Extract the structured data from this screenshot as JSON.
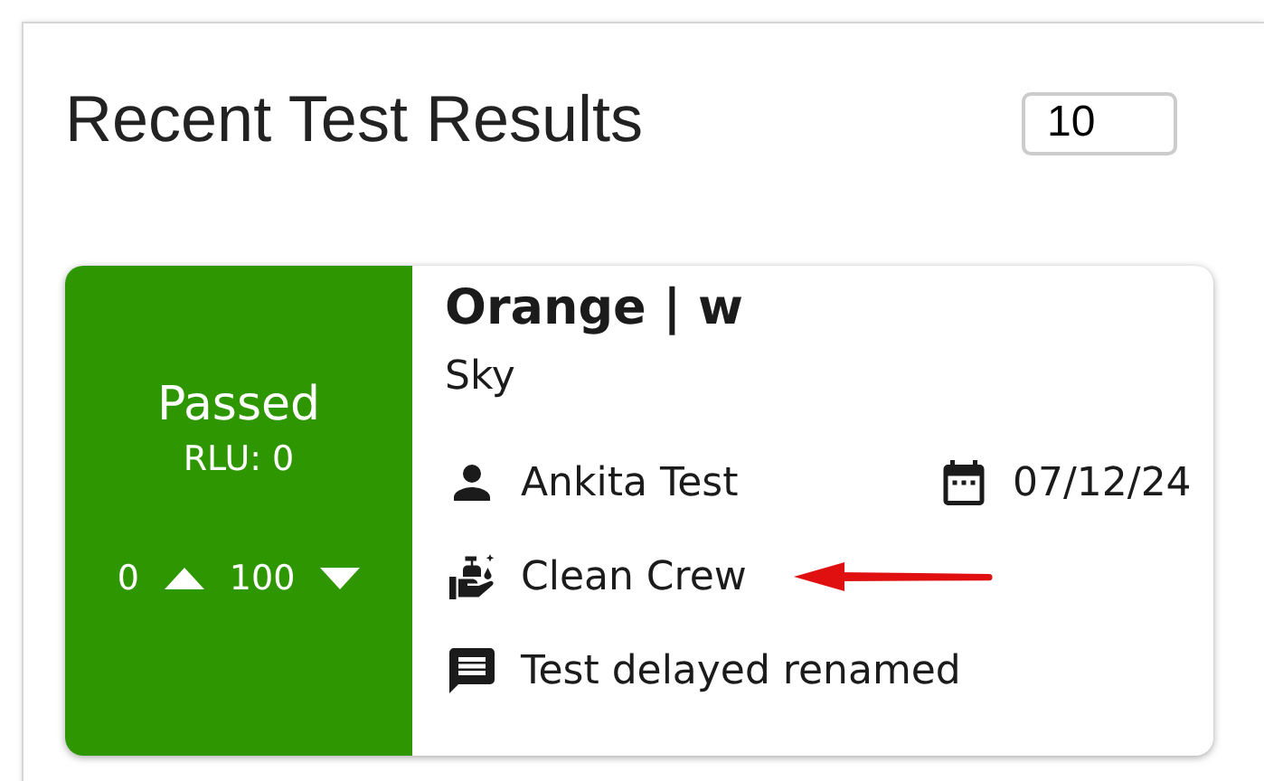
{
  "panel": {
    "title": "Recent Test Results",
    "count_field": {
      "value": "10"
    }
  },
  "results": [
    {
      "status": "Passed",
      "color": "#2e9600",
      "rlu": "RLU: 0",
      "low": "0",
      "high": "100",
      "name": "Orange | w",
      "location": "Sky",
      "user": "Ankita Test",
      "date": "07/12/24",
      "team": "Clean Crew",
      "team_highlighted": true,
      "note": "Test delayed renamed"
    }
  ]
}
